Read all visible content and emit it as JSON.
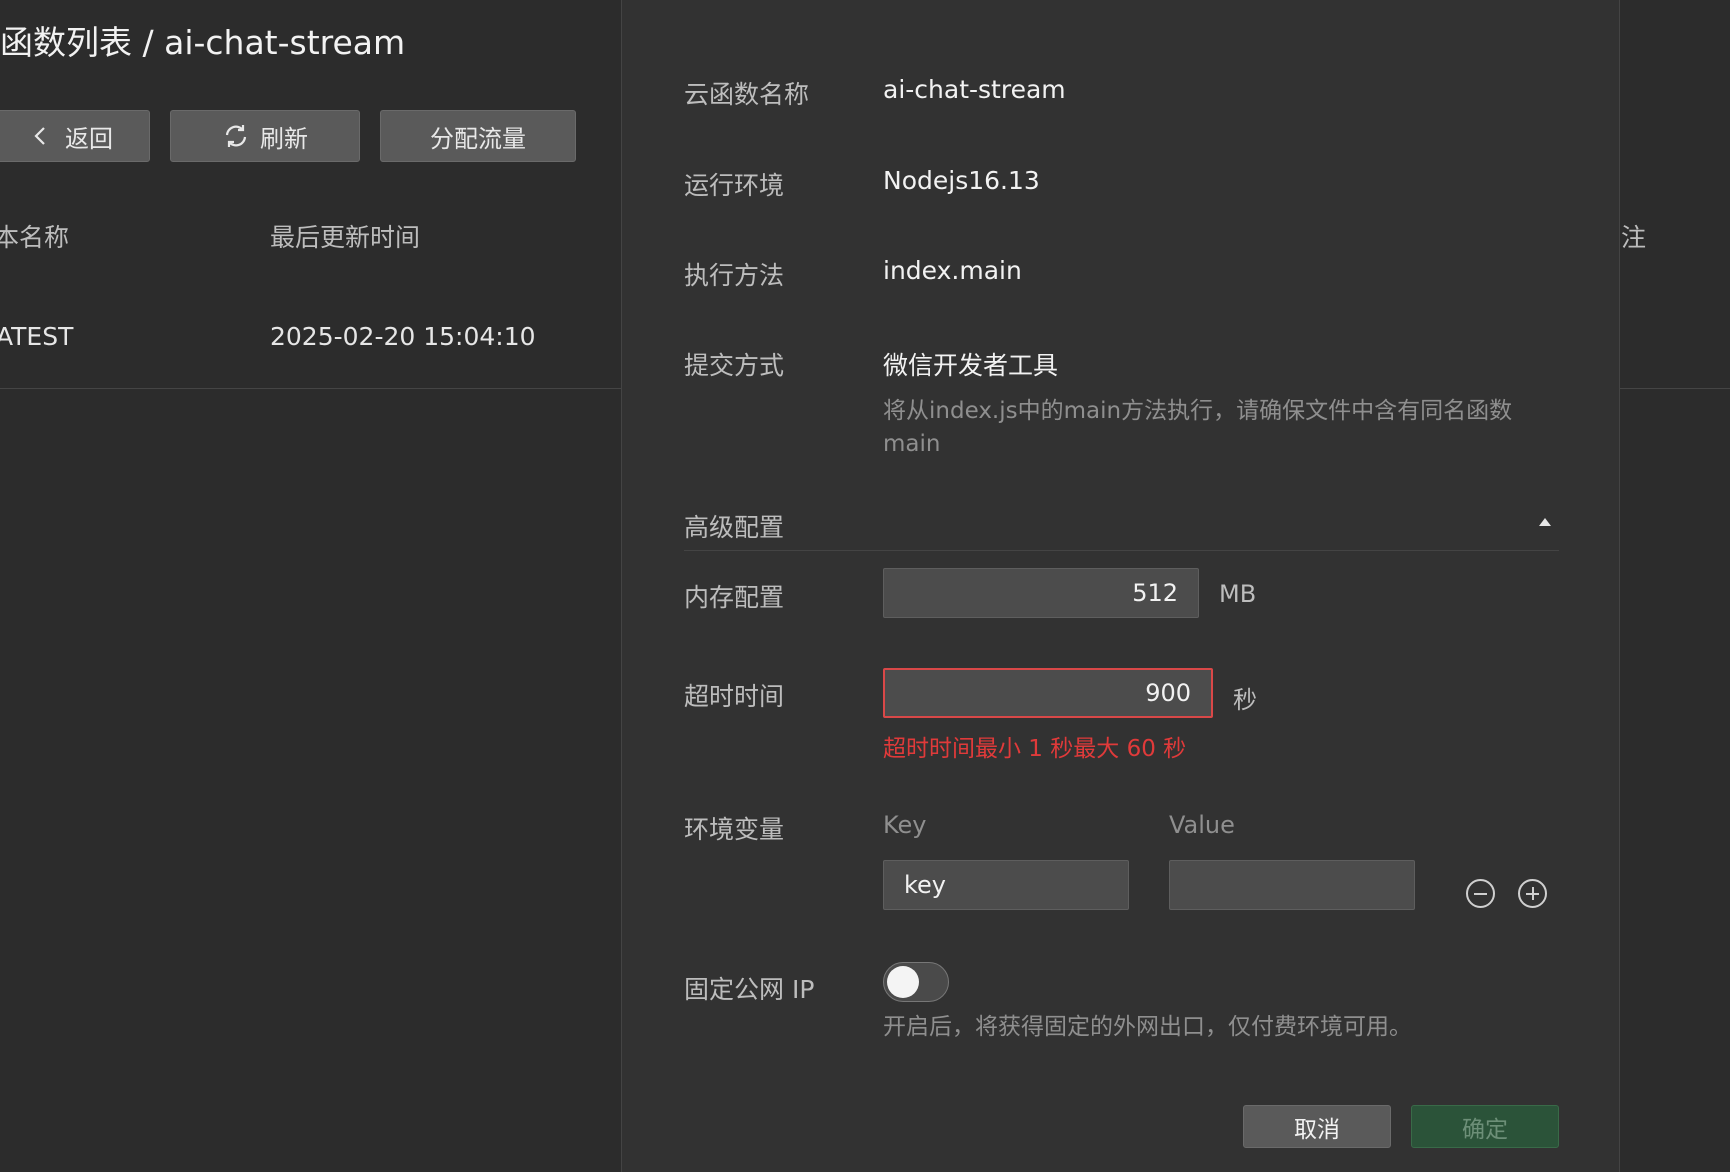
{
  "background": {
    "title": "函数列表 / ai-chat-stream",
    "buttons": {
      "back": "返回",
      "refresh": "刷新",
      "traffic": "分配流量"
    },
    "columns": {
      "version_name": "本名称",
      "last_updated": "最后更新时间",
      "remark": "注"
    },
    "row": {
      "version": "ATEST",
      "updated_at": "2025-02-20 15:04:10"
    }
  },
  "dialog": {
    "fields": {
      "name_label": "云函数名称",
      "name_value": "ai-chat-stream",
      "runtime_label": "运行环境",
      "runtime_value": "Nodejs16.13",
      "handler_label": "执行方法",
      "handler_value": "index.main",
      "submit_label": "提交方式",
      "submit_value": "微信开发者工具",
      "handler_hint": "将从index.js中的main方法执行，请确保文件中含有同名函数 main"
    },
    "advanced": {
      "title": "高级配置",
      "memory_label": "内存配置",
      "memory_value": "512",
      "memory_unit": "MB",
      "timeout_label": "超时时间",
      "timeout_value": "900",
      "timeout_unit": "秒",
      "timeout_error": "超时时间最小 1 秒最大 60 秒",
      "env_label": "环境变量",
      "env_key_header": "Key",
      "env_value_header": "Value",
      "env_key_value": "key",
      "env_value_value": "",
      "fixed_ip_label": "固定公网 IP",
      "fixed_ip_enabled": false,
      "fixed_ip_hint": "开启后，将获得固定的外网出口，仅付费环境可用。"
    },
    "footer": {
      "cancel": "取消",
      "confirm": "确定"
    }
  },
  "colors": {
    "error": "#e03a3a",
    "confirm_bg": "#2b5339",
    "panel_bg": "#323232",
    "page_bg": "#2c2c2c"
  }
}
